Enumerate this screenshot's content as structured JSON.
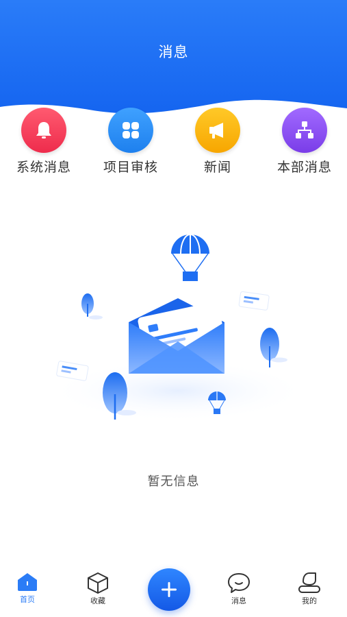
{
  "header": {
    "title": "消息"
  },
  "categories": [
    {
      "label": "系统消息",
      "icon": "bell-icon",
      "color": "#f33e5c"
    },
    {
      "label": "项目审核",
      "icon": "grid-icon",
      "color": "#2b8df5"
    },
    {
      "label": "新闻",
      "icon": "megaphone-icon",
      "color": "#f5b500"
    },
    {
      "label": "本部消息",
      "icon": "hierarchy-icon",
      "color": "#8b4ff0"
    }
  ],
  "empty_state": {
    "text": "暂无信息"
  },
  "tabbar": {
    "items": [
      {
        "label": "首页",
        "icon": "home-icon",
        "active": true
      },
      {
        "label": "收藏",
        "icon": "cube-icon",
        "active": false
      },
      {
        "label": "消息",
        "icon": "chat-icon",
        "active": false
      },
      {
        "label": "我的",
        "icon": "user-icon",
        "active": false
      }
    ],
    "center_button_icon": "plus-icon"
  },
  "colors": {
    "primary": "#1a6ef5",
    "accent": "#2b7cf6"
  }
}
